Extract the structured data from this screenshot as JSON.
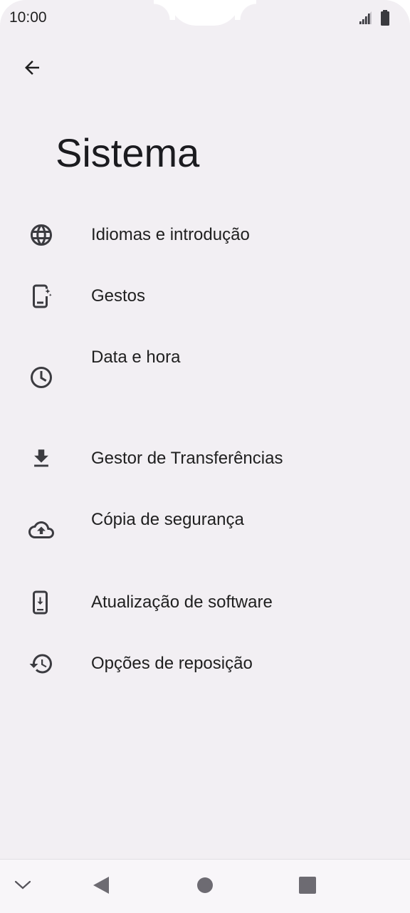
{
  "status_bar": {
    "time": "10:00",
    "signal_icon": "signal-icon",
    "battery_icon": "battery-icon"
  },
  "header": {
    "back_icon": "arrow-back-icon",
    "title": "Sistema"
  },
  "menu": {
    "items": [
      {
        "label": "Idiomas e introdução",
        "icon": "globe-icon"
      },
      {
        "label": "Gestos",
        "icon": "phone-gesture-icon"
      },
      {
        "label": "Data e hora",
        "icon": "clock-icon"
      },
      {
        "label": "Gestor de Transferências",
        "icon": "download-icon"
      },
      {
        "label": "Cópia de segurança",
        "icon": "cloud-upload-icon"
      },
      {
        "label": "Atualização de software",
        "icon": "system-update-icon"
      },
      {
        "label": "Opções de reposição",
        "icon": "history-icon"
      }
    ]
  },
  "navigation_bar": {
    "collapse_icon": "chevron-down-icon",
    "back_icon": "triangle-back-icon",
    "home_icon": "circle-home-icon",
    "recents_icon": "square-recents-icon"
  },
  "colors": {
    "background": "#f2eff3",
    "text": "#1f1f1f",
    "icon": "#3b3b40",
    "navbar": "#f8f6f9"
  }
}
